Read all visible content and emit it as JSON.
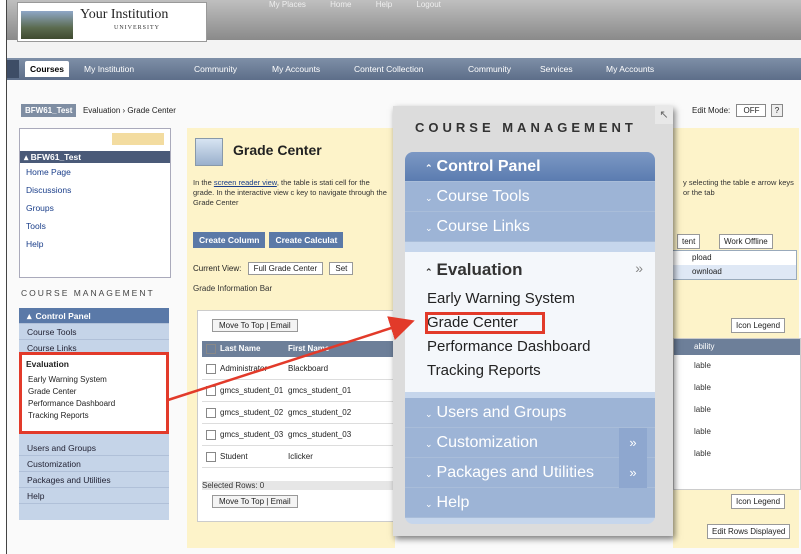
{
  "header": {
    "institution": "Your Institution",
    "institution_sub": "UNIVERSITY",
    "top_links": [
      "My Places",
      "Home",
      "Help",
      "Logout"
    ]
  },
  "tabs": [
    "Courses",
    "My Institution",
    "Community",
    "My Accounts",
    "Content Collection",
    "Community",
    "Services",
    "My Accounts"
  ],
  "breadcrumb": {
    "course": "BFW61_Test",
    "path": "Evaluation › Grade Center"
  },
  "edit_mode": {
    "label": "Edit Mode:",
    "value": "OFF",
    "help": "?"
  },
  "course_menu": {
    "title": "BFW61_Test",
    "items": [
      "Home Page",
      "Discussions",
      "Groups",
      "Tools",
      "Help"
    ]
  },
  "course_management_heading": "COURSE MANAGEMENT",
  "control_panel": {
    "title": "Control Panel",
    "items": [
      "Course Tools",
      "Course Links"
    ],
    "evaluation": "Evaluation",
    "evaluation_items": [
      "Early Warning System",
      "Grade Center",
      "Performance Dashboard",
      "Tracking Reports"
    ],
    "after_items": [
      "Users and Groups",
      "Customization",
      "Packages and Utilities",
      "Help"
    ]
  },
  "grade_center": {
    "title": "Grade Center",
    "desc_link": "screen reader view",
    "desc_pre": "In the",
    "desc_post": ", the table is stati cell for the grade. In the interactive view c key to navigate through the Grade Center",
    "right_desc": "y selecting the table e arrow keys or the tab",
    "buttons": [
      "Create Column",
      "Create Calculat"
    ],
    "current_view_label": "Current View:",
    "current_view_value": "Full Grade Center",
    "set_label": "Set",
    "info_bar": "Grade Information Bar",
    "top_buttons": [
      "Move To Top",
      "Email"
    ],
    "columns": [
      "Last Name",
      "First Name"
    ],
    "rows": [
      [
        "Administrator",
        "Blackboard"
      ],
      [
        "gmcs_student_01",
        "gmcs_student_01"
      ],
      [
        "gmcs_student_02",
        "gmcs_student_02"
      ],
      [
        "gmcs_student_03",
        "gmcs_student_03"
      ],
      [
        "Student",
        "Iclicker"
      ]
    ],
    "selected_rows": "Selected Rows: 0",
    "icon_legend": "Icon Legend",
    "work_offline": "Work Offline",
    "ent": "tent",
    "upload": "pload",
    "download": "ownload",
    "availability_header": "ability",
    "availability_cells": [
      "lable",
      "lable",
      "lable",
      "lable",
      "lable"
    ],
    "edit_rows": "Edit Rows Displayed"
  },
  "overlay": {
    "title": "COURSE MANAGEMENT",
    "control_panel": "Control Panel",
    "course_tools": "Course Tools",
    "course_links": "Course Links",
    "evaluation": "Evaluation",
    "more": "»",
    "evaluation_items": [
      "Early Warning System",
      "Grade Center",
      "Performance Dashboard",
      "Tracking Reports"
    ],
    "users_and_groups": "Users and Groups",
    "customization": "Customization",
    "packages": "Packages and Utilities",
    "help": "Help"
  },
  "colors": {
    "highlight": "#e23a2a",
    "panel_blue": "#5b7cb0",
    "menu_bg": "#c6d6ec"
  }
}
